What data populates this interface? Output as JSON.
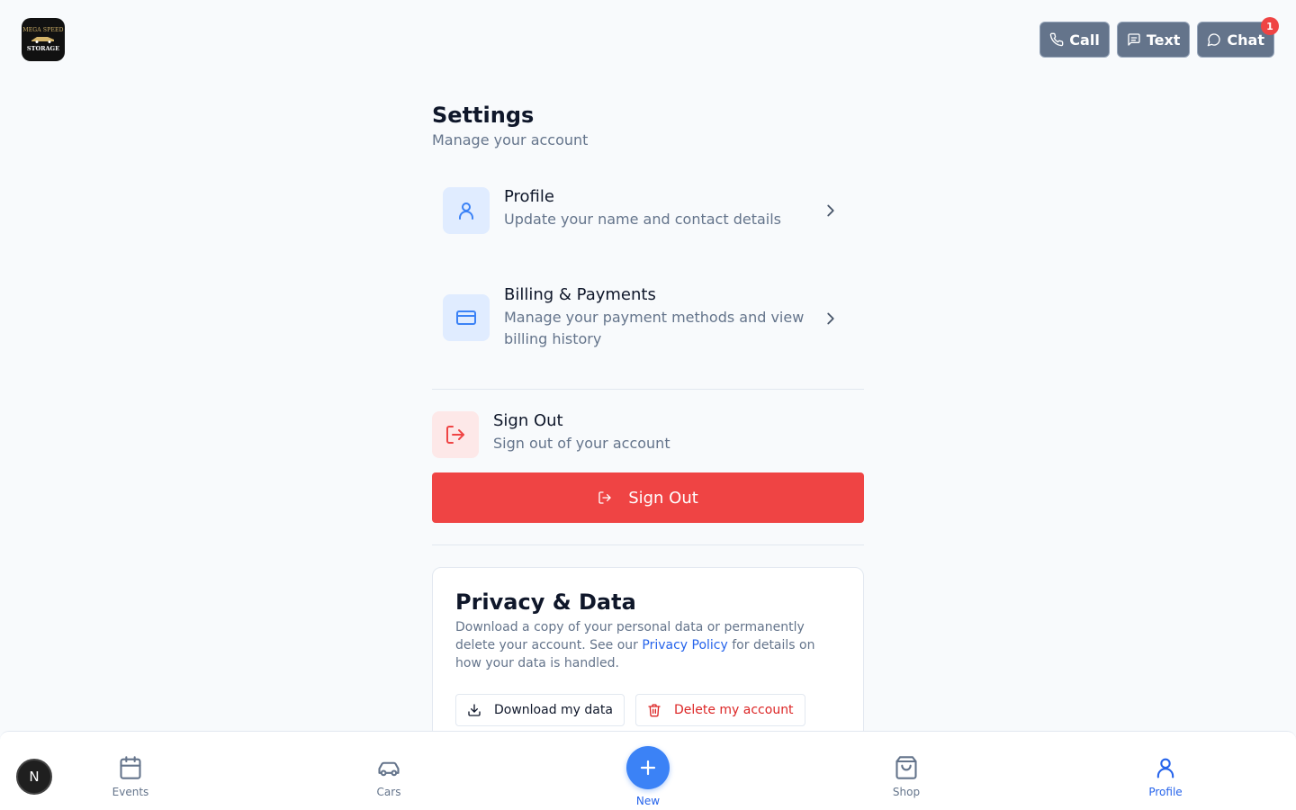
{
  "header": {
    "logo_text_top": "MEGA SPEED",
    "logo_text_bottom": "STORAGE",
    "actions": [
      {
        "label": "Call",
        "icon": "phone-icon"
      },
      {
        "label": "Text",
        "icon": "message-square-icon"
      },
      {
        "label": "Chat",
        "icon": "chat-bubble-icon",
        "badge": "1"
      }
    ]
  },
  "page": {
    "title": "Settings",
    "subtitle": "Manage your account"
  },
  "settings": {
    "profile": {
      "title": "Profile",
      "desc": "Update your name and contact details"
    },
    "billing": {
      "title": "Billing & Payments",
      "desc": "Manage your payment methods and view billing history"
    },
    "signout": {
      "title": "Sign Out",
      "desc": "Sign out of your account",
      "button_label": "Sign Out"
    }
  },
  "privacy": {
    "title": "Privacy & Data",
    "text_before": "Download a copy of your personal data or permanently delete your account. See our ",
    "link_text": "Privacy Policy",
    "text_after": " for details on how your data is handled.",
    "download_label": "Download my data",
    "delete_label": "Delete my account"
  },
  "bottom_nav": {
    "avatar_initial": "N",
    "items": [
      {
        "label": "Events"
      },
      {
        "label": "Cars"
      },
      {
        "label": "New"
      },
      {
        "label": "Shop"
      },
      {
        "label": "Profile"
      }
    ]
  },
  "colors": {
    "accent": "#3b82f6",
    "danger": "#ef4444",
    "header_button": "#64748b"
  }
}
